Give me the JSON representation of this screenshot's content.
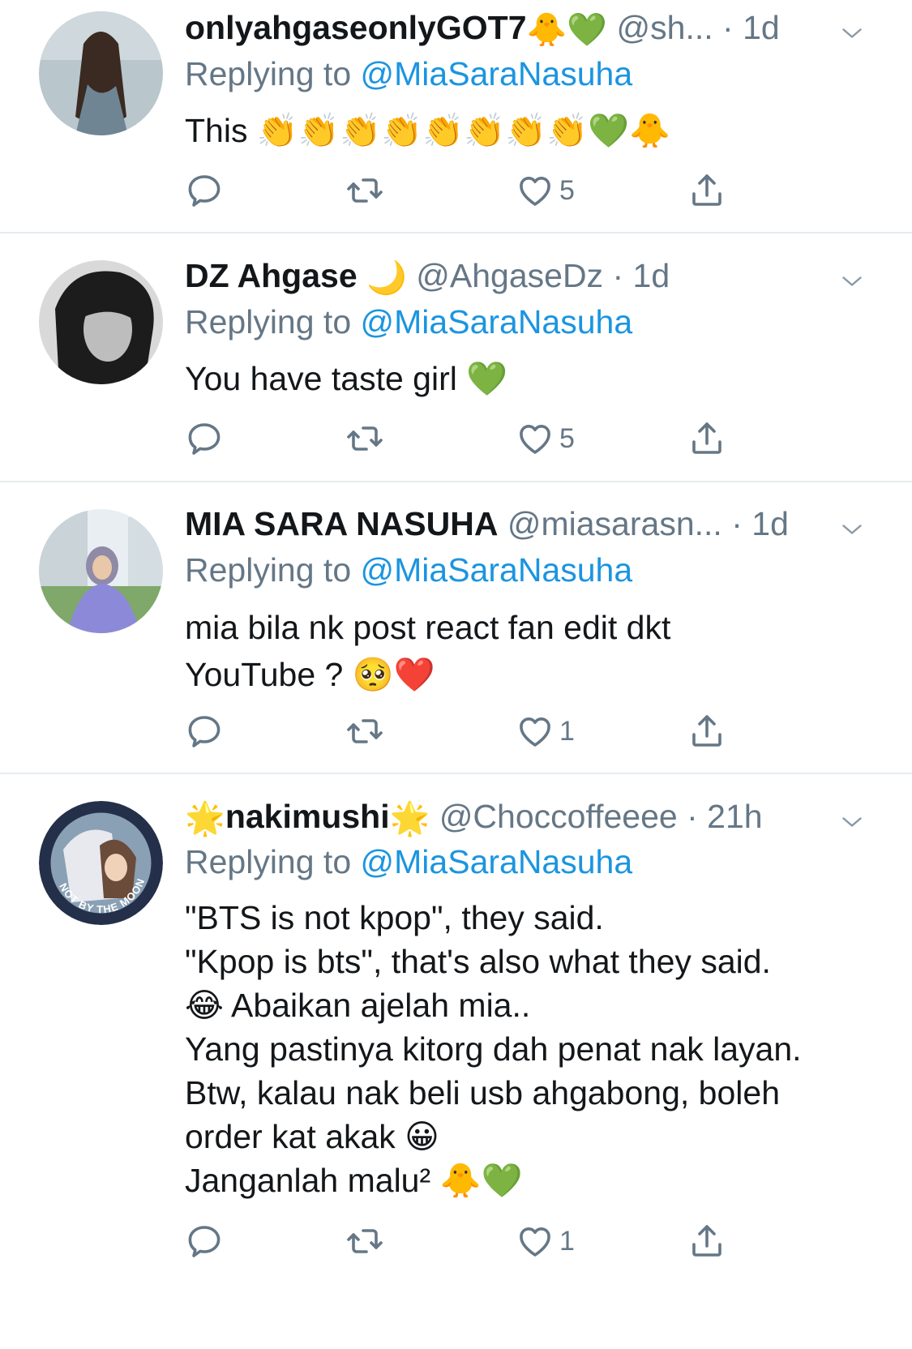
{
  "colors": {
    "link": "#1b95e0",
    "muted": "#657786",
    "text": "#14171a",
    "separator": "#e6ecf0"
  },
  "tweets": [
    {
      "name": "onlyahgaseonlyGOT7",
      "name_emoji": "🐥💚",
      "handle": "@sh...",
      "dot": "·",
      "time": "1d",
      "replying_prefix": "Replying to",
      "replying_to": "@MiaSaraNasuha",
      "lines": [
        "This 👏👏👏👏👏👏👏👏💚🐥"
      ],
      "likes": "5",
      "icons": [
        "reply-icon",
        "retweet-icon",
        "like-icon",
        "share-icon",
        "chevron-down-icon"
      ]
    },
    {
      "name": "DZ Ahgase",
      "name_emoji": "🌙",
      "handle": "@AhgaseDz",
      "dot": "·",
      "time": "1d",
      "replying_prefix": "Replying to",
      "replying_to": "@MiaSaraNasuha",
      "lines": [
        "You have taste girl 💚"
      ],
      "likes": "5"
    },
    {
      "name": "MIA SARA NASUHA",
      "name_emoji": "",
      "handle": "@miasarasn...",
      "dot": "·",
      "time": "1d",
      "replying_prefix": "Replying to",
      "replying_to": "@MiaSaraNasuha",
      "lines": [
        "mia bila nk post react fan edit dkt",
        "YouTube ? 🥺❤️"
      ],
      "likes": "1"
    },
    {
      "name": "nakimushi",
      "name_emoji_before": "🌟",
      "name_emoji": "🌟",
      "handle": "@Choccoffeeee",
      "dot": "·",
      "time": "21h",
      "replying_prefix": "Replying to",
      "replying_to": "@MiaSaraNasuha",
      "lines": [
        "\"BTS is not kpop\", they said.",
        "\"Kpop is bts\", that's also what they said.",
        "😂 Abaikan ajelah mia..",
        "Yang pastinya kitorg dah penat nak layan.",
        "Btw, kalau nak beli usb ahgabong, boleh",
        "order kat akak 😀",
        "Janganlah malu² 🐥💚"
      ],
      "likes": "1",
      "avatar_text": "NOT BY THE MOON"
    }
  ]
}
